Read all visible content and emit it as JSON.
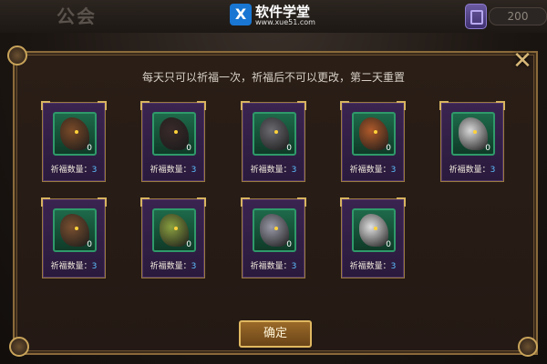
{
  "header": {
    "guild_title": "公会",
    "currency_amount": "200",
    "currency_icon": "gem-icon"
  },
  "watermark": {
    "logo_text": "X",
    "name": "软件学堂",
    "url": "www.xue51.com"
  },
  "dialog": {
    "instruction": "每天只可以祈福一次，祈福后不可以更改，第二天重置",
    "confirm_label": "确定",
    "close_icon": "close-icon",
    "blessing_label": "祈福数量：",
    "cards": [
      {
        "beast": "wild-boar",
        "count": "0",
        "blessings": "3",
        "color": "#7a4a28"
      },
      {
        "beast": "black-dragon",
        "count": "0",
        "blessings": "3",
        "color": "#3a2a2a"
      },
      {
        "beast": "wolf",
        "count": "0",
        "blessings": "3",
        "color": "#6a6a70"
      },
      {
        "beast": "red-dragon",
        "count": "0",
        "blessings": "3",
        "color": "#b05a2a"
      },
      {
        "beast": "white-horse",
        "count": "0",
        "blessings": "3",
        "color": "#d8d8d8"
      },
      {
        "beast": "bear",
        "count": "0",
        "blessings": "3",
        "color": "#7a5030"
      },
      {
        "beast": "green-dragon",
        "count": "0",
        "blessings": "3",
        "color": "#8aa040"
      },
      {
        "beast": "griffin",
        "count": "0",
        "blessings": "3",
        "color": "#9a9aa8"
      },
      {
        "beast": "unicorn",
        "count": "0",
        "blessings": "3",
        "color": "#e0e0e0"
      }
    ]
  }
}
